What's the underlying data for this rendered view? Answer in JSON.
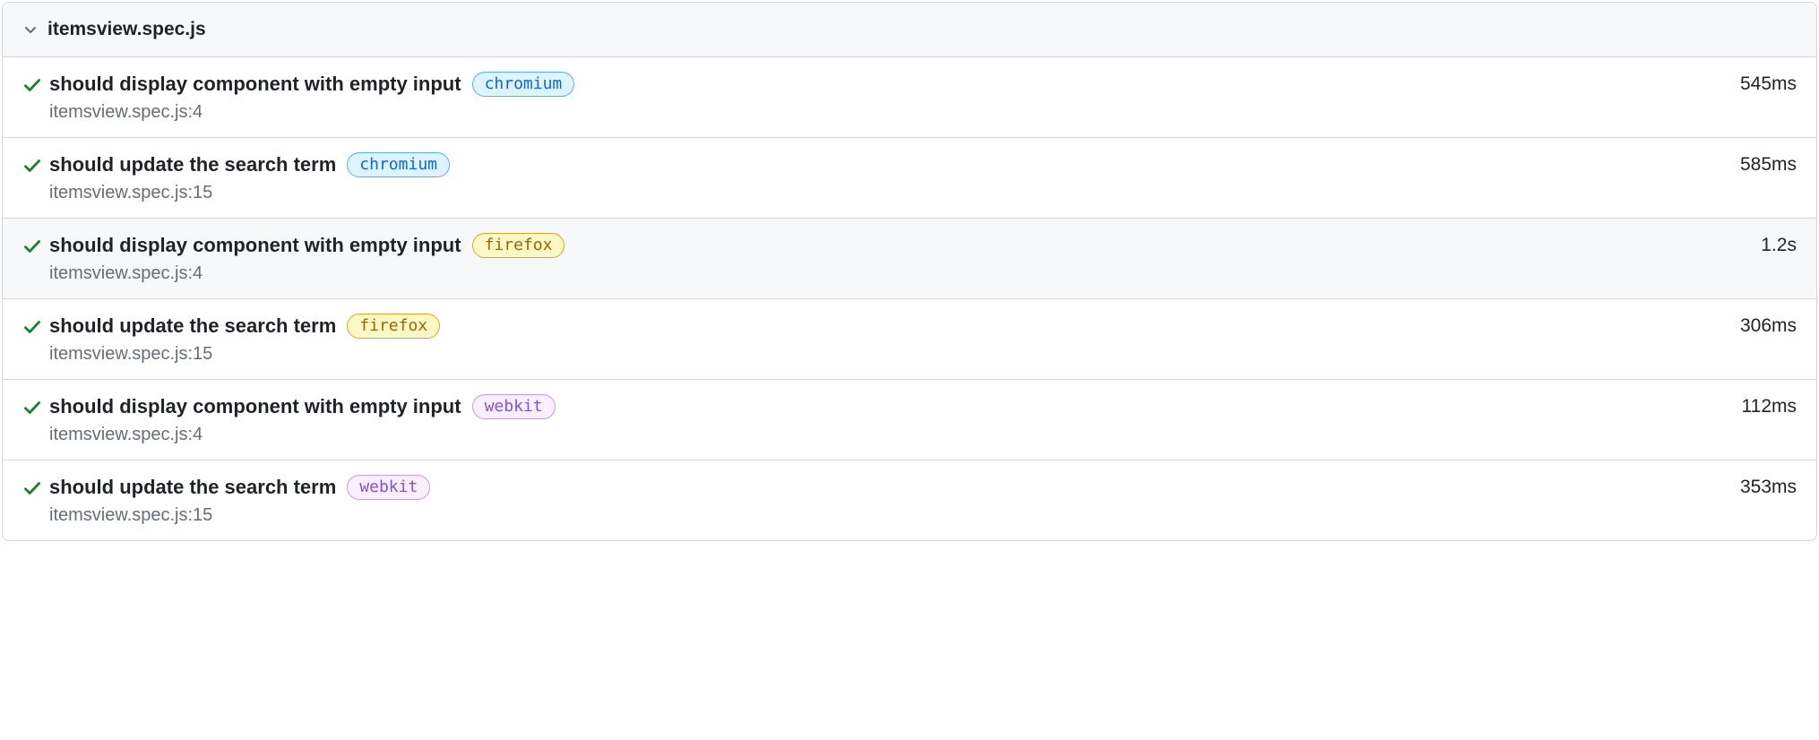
{
  "header": {
    "file": "itemsview.spec.js"
  },
  "browsers": {
    "chromium": {
      "label": "chromium",
      "pillClass": "pill-chromium"
    },
    "firefox": {
      "label": "firefox",
      "pillClass": "pill-firefox"
    },
    "webkit": {
      "label": "webkit",
      "pillClass": "pill-webkit"
    }
  },
  "tests": [
    {
      "status": "passed",
      "title": "should display component with empty input",
      "browser": "chromium",
      "location": "itemsview.spec.js:4",
      "duration": "545ms",
      "highlight": false
    },
    {
      "status": "passed",
      "title": "should update the search term",
      "browser": "chromium",
      "location": "itemsview.spec.js:15",
      "duration": "585ms",
      "highlight": false
    },
    {
      "status": "passed",
      "title": "should display component with empty input",
      "browser": "firefox",
      "location": "itemsview.spec.js:4",
      "duration": "1.2s",
      "highlight": true
    },
    {
      "status": "passed",
      "title": "should update the search term",
      "browser": "firefox",
      "location": "itemsview.spec.js:15",
      "duration": "306ms",
      "highlight": false
    },
    {
      "status": "passed",
      "title": "should display component with empty input",
      "browser": "webkit",
      "location": "itemsview.spec.js:4",
      "duration": "112ms",
      "highlight": false
    },
    {
      "status": "passed",
      "title": "should update the search term",
      "browser": "webkit",
      "location": "itemsview.spec.js:15",
      "duration": "353ms",
      "highlight": false
    }
  ]
}
